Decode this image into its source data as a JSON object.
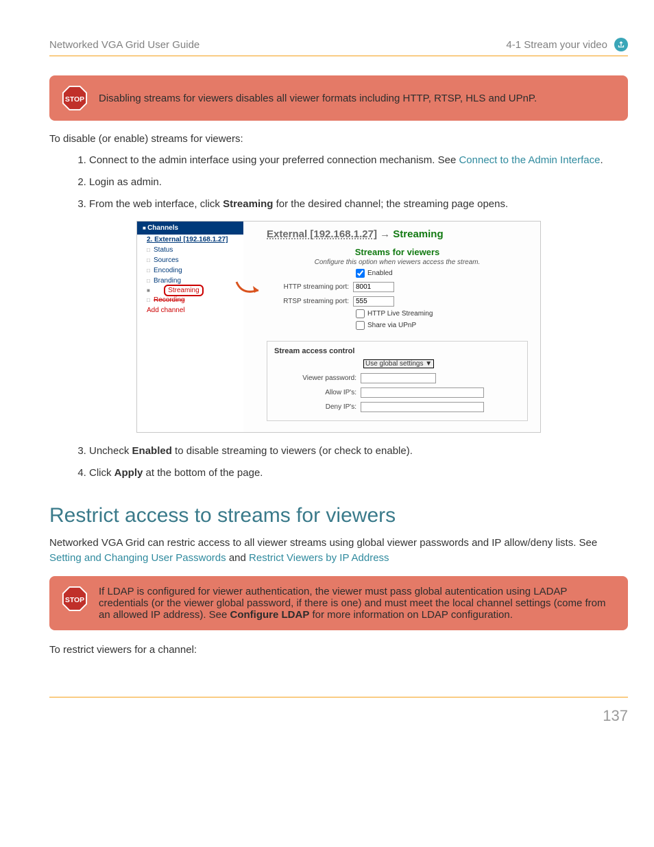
{
  "header": {
    "left": "Networked VGA Grid User Guide",
    "right": "4-1 Stream your video"
  },
  "callout1": {
    "icon_label": "STOP",
    "text": "Disabling streams for viewers disables all viewer formats including HTTP, RTSP, HLS and UPnP."
  },
  "intro": "To disable (or enable) streams for viewers:",
  "steps_a": {
    "s1_pre": "Connect to the admin interface using your preferred connection mechanism. See ",
    "s1_link": "Connect to the Admin Interface",
    "s1_post": ".",
    "s2": "Login as admin.",
    "s3_pre": "From the web interface, click ",
    "s3_bold": "Streaming",
    "s3_post": " for the desired channel; the streaming page opens."
  },
  "screenshot": {
    "channels_hdr": "Channels",
    "sub": "2. External [192.168.1.27]",
    "items": [
      "Status",
      "Sources",
      "Encoding",
      "Branding"
    ],
    "highlight": "Streaming",
    "strike": "Recording",
    "add": "Add channel",
    "title_ext": "External [192.168.1.27]",
    "title_arrow": " → ",
    "title_stream": "Streaming",
    "sec_hdr": "Streams for viewers",
    "desc": "Configure this option when viewers access the stream.",
    "enabled_label": "Enabled",
    "http_label": "HTTP streaming port:",
    "http_val": "8001",
    "rtsp_label": "RTSP streaming port:",
    "rtsp_val": "555",
    "hls_label": "HTTP Live Streaming",
    "upnp_label": "Share via UPnP",
    "sec2_hdr": "Stream access control",
    "select_val": "Use global settings ▼",
    "viewer_pw": "Viewer password:",
    "allow": "Allow IP's:",
    "deny": "Deny IP's:"
  },
  "steps_b": {
    "s3_pre": "Uncheck ",
    "s3_bold": "Enabled",
    "s3_post": " to disable streaming to viewers (or check to enable).",
    "s4_pre": "Click ",
    "s4_bold": "Apply",
    "s4_post": " at the bottom of the page."
  },
  "heading2": "Restrict access to streams for viewers",
  "para2_pre": "Networked VGA Grid can restric access to all viewer streams using global viewer passwords and IP allow/deny lists. See ",
  "para2_link1": "Setting and Changing User Passwords",
  "para2_mid": " and ",
  "para2_link2": "Restrict Viewers by IP Address",
  "callout2": {
    "icon_label": "STOP",
    "t1": "If LDAP is configured for viewer authentication, the viewer must pass global autentication using LADAP credentials (or the viewer global password, if there is one) and must meet the local channel settings (come from an allowed IP address). See ",
    "bold": "Configure LDAP",
    "t2": " for more information on LDAP configuration."
  },
  "outro": "To restrict viewers for a channel:",
  "page_number": "137"
}
